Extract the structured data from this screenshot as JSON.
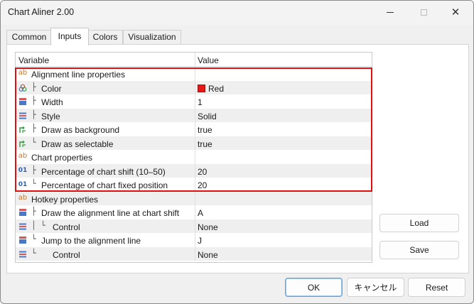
{
  "window": {
    "title": "Chart Aliner 2.00",
    "close_glyph": "✕"
  },
  "tabs": [
    {
      "label": "Common"
    },
    {
      "label": "Inputs"
    },
    {
      "label": "Colors"
    },
    {
      "label": "Visualization"
    }
  ],
  "grid": {
    "header": {
      "variable": "Variable",
      "value": "Value"
    },
    "rows": [
      {
        "tree": "",
        "label": "Alignment line properties",
        "value": "",
        "icon": "ab-icon"
      },
      {
        "tree": "├",
        "label": "Color",
        "value": "Red",
        "icon": "color-icon"
      },
      {
        "tree": "├",
        "label": "Width",
        "value": "1",
        "icon": "width-icon"
      },
      {
        "tree": "├",
        "label": "Style",
        "value": "Solid",
        "icon": "style-icon"
      },
      {
        "tree": "├",
        "label": "Draw as background",
        "value": "true",
        "icon": "bool-icon"
      },
      {
        "tree": "└",
        "label": "Draw as selectable",
        "value": "true",
        "icon": "bool-icon"
      },
      {
        "tree": "",
        "label": "Chart properties",
        "value": "",
        "icon": "ab-icon"
      },
      {
        "tree": "├",
        "label": "Percentage of chart shift (10–50)",
        "value": "20",
        "icon": "number-icon"
      },
      {
        "tree": "└",
        "label": "Percentage of chart fixed position",
        "value": "20",
        "icon": "number-icon"
      },
      {
        "tree": "",
        "label": "Hotkey properties",
        "value": "",
        "icon": "ab-icon"
      },
      {
        "tree": "├",
        "label": "Draw the alignment line at chart shift",
        "value": "A",
        "icon": "width-icon"
      },
      {
        "tree": "│ └",
        "label": "Control",
        "value": "None",
        "icon": "style-icon"
      },
      {
        "tree": "└",
        "label": "Jump to the alignment line",
        "value": "J",
        "icon": "width-icon"
      },
      {
        "tree": "  └",
        "label": "Control",
        "value": "None",
        "icon": "style-icon"
      }
    ]
  },
  "side_buttons": {
    "load": "Load",
    "save": "Save"
  },
  "footer_buttons": {
    "ok": "OK",
    "cancel": "キャンセル",
    "reset": "Reset"
  },
  "colors": {
    "highlight": "#e01010",
    "swatch_red": "#e61919",
    "accent": "#6aa3d8"
  }
}
